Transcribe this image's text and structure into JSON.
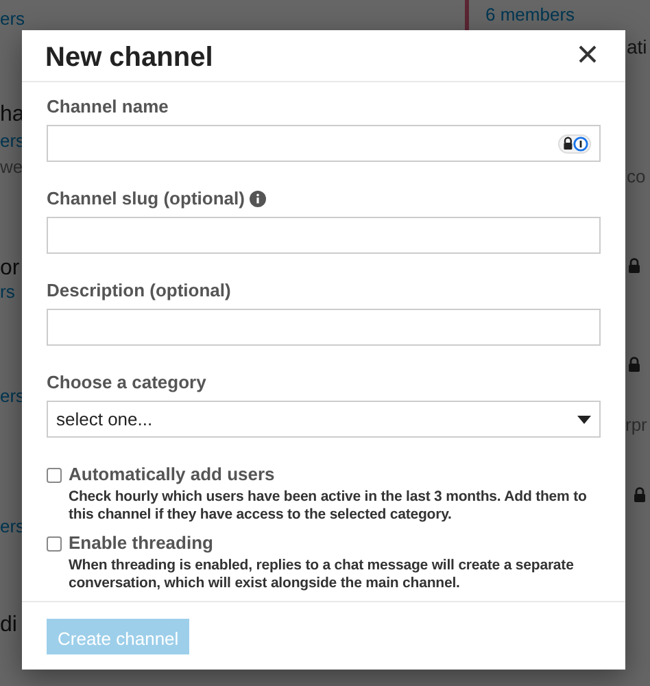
{
  "background": [
    {
      "text": "ers",
      "kind": "link"
    },
    {
      "text": "6 members",
      "kind": "link"
    },
    {
      "text": "ati",
      "kind": "plain"
    },
    {
      "text": "ha",
      "kind": "heading"
    },
    {
      "text": "ers",
      "kind": "link"
    },
    {
      "text": "we",
      "kind": "muted"
    },
    {
      "text": "co",
      "kind": "muted"
    },
    {
      "text": "or",
      "kind": "heading"
    },
    {
      "text": "rs",
      "kind": "link"
    },
    {
      "text": "ers",
      "kind": "link"
    },
    {
      "text": "rpr",
      "kind": "muted"
    },
    {
      "text": "ers",
      "kind": "link"
    },
    {
      "text": "di",
      "kind": "heading"
    }
  ],
  "modal": {
    "title": "New channel",
    "fields": [
      {
        "kind": "autofill",
        "label": "Channel name"
      },
      {
        "kind": "info",
        "label": "Channel slug (optional)"
      },
      {
        "kind": "text",
        "label": "Description (optional)"
      },
      {
        "kind": "select",
        "label": "Choose a category",
        "value": "select one..."
      }
    ],
    "options": [
      {
        "label": "Automatically add users",
        "help": "Check hourly which users have been active in the last 3 months. Add them to this channel if they have access to the selected category.",
        "checked": false
      },
      {
        "label": "Enable threading",
        "help": "When threading is enabled, replies to a chat message will create a separate conversation, which will exist alongside the main channel.",
        "checked": false
      }
    ],
    "submit": {
      "label": "Create channel",
      "disabled": true
    }
  }
}
